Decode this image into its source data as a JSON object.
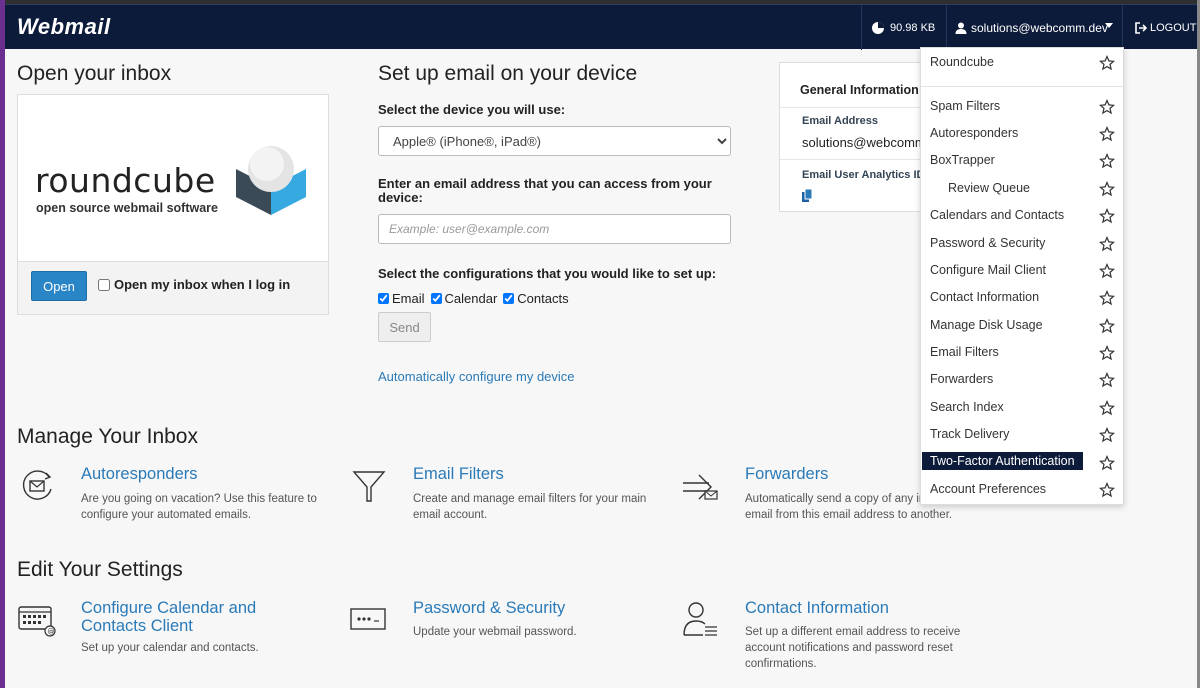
{
  "header": {
    "logo": "Webmail",
    "disk_usage": "90.98 KB",
    "user": "solutions@webcomm.dev",
    "logout": "LOGOUT"
  },
  "open_inbox": {
    "title": "Open your inbox",
    "logo_word": "roundcube",
    "logo_sub": "open source webmail software",
    "open_button": "Open",
    "checkbox_label": "Open my inbox when I log in"
  },
  "setup": {
    "title": "Set up email on your device",
    "device_label": "Select the device you will use:",
    "device_selected": "Apple® (iPhone®, iPad®)",
    "email_label": "Enter an email address that you can access from your device:",
    "email_placeholder": "Example: user@example.com",
    "config_label": "Select the configurations that you would like to set up:",
    "configs": [
      "Email",
      "Calendar",
      "Contacts"
    ],
    "send_button": "Send",
    "auto_link": "Automatically configure my device"
  },
  "general_info": {
    "title": "General Information",
    "email_label": "Email Address",
    "email_value": "solutions@webcomm.dev",
    "analytics_label": "Email User Analytics ID"
  },
  "dropdown": {
    "items": [
      "Roundcube",
      "Spam Filters",
      "Autoresponders",
      "BoxTrapper",
      "Review Queue",
      "Calendars and Contacts",
      "Password & Security",
      "Configure Mail Client",
      "Contact Information",
      "Manage Disk Usage",
      "Email Filters",
      "Forwarders",
      "Search Index",
      "Track Delivery",
      "Two-Factor Authentication",
      "Account Preferences"
    ]
  },
  "manage": {
    "title": "Manage Your Inbox",
    "tools": [
      {
        "title": "Autoresponders",
        "desc": "Are you going on vacation? Use this feature to configure your automated emails."
      },
      {
        "title": "Email Filters",
        "desc": "Create and manage email filters for your main email account."
      },
      {
        "title": "Forwarders",
        "desc": "Automatically send a copy of any incoming email from this email address to another."
      }
    ]
  },
  "settings": {
    "title": "Edit Your Settings",
    "tools": [
      {
        "title": "Configure Calendar and Contacts Client",
        "desc": "Set up your calendar and contacts."
      },
      {
        "title": "Password & Security",
        "desc": "Update your webmail password."
      },
      {
        "title": "Contact Information",
        "desc": "Set up a different email address to receive account notifications and password reset confirmations."
      }
    ]
  },
  "colors": {
    "topbar": "#0d1b3a",
    "link": "#2a7ab8",
    "primary_button": "#2a85c7",
    "roundcube_blue": "#37a9e1",
    "roundcube_dark": "#3b4a57"
  }
}
